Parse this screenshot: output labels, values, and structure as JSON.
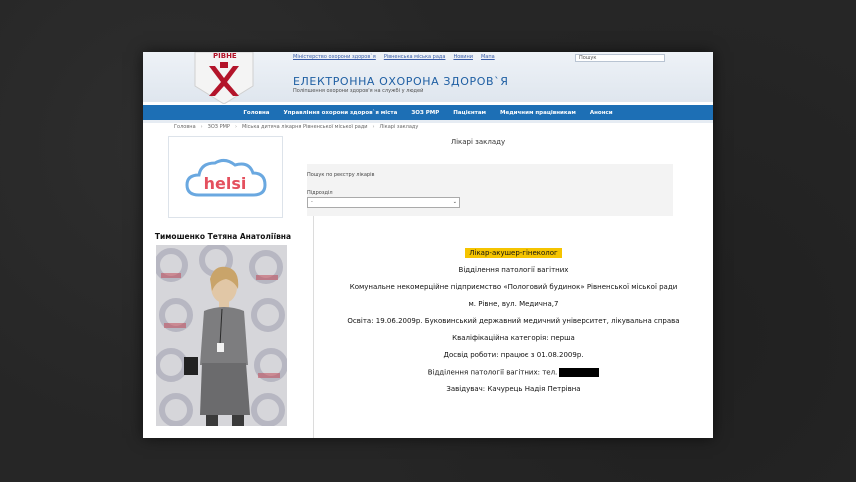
{
  "header": {
    "emblem_text": "РІВНЕ",
    "top_links": [
      "Міністерство охорони здоров`я",
      "Рівненська міська рада",
      "Новини",
      "Мапа"
    ],
    "search_placeholder": "Пошук",
    "title": "ЕЛЕКТРОННА ОХОРОНА ЗДОРОВ`Я",
    "subtitle": "Поліпшення охорони здоров'я на службі у людей"
  },
  "nav": [
    "Головна",
    "Управління охорони здоров`я міста",
    "ЗОЗ РМР",
    "Пацієнтам",
    "Медичним працівникам",
    "Анонси"
  ],
  "breadcrumbs": [
    "Головна",
    "ЗОЗ РМР",
    "Міська дитяча лікарня Рівненської міської ради",
    "Лікарі закладу"
  ],
  "helsi_logo": "helsi",
  "doctor_name": "Тимошенко Тетяна Анатоліївна",
  "section_title": "Лікарі закладу",
  "filter": {
    "search_label": "Пошук по реєстру лікарів",
    "department_label": "Підрозділ",
    "department_value": "-"
  },
  "details": {
    "specialty": "Лікар-акушер-гінеколог",
    "department": "Відділення патології вагітних",
    "institution": "Комунальне некомерційне підприємство «Пологовий будинок» Рівненської міської ради",
    "address": "м. Рівне, вул. Медична,7",
    "education": "Освіта:   19.06.2009р. Буковинський державний медичний університет, лікувальна справа",
    "qualification": "Кваліфікаційна категорія: перша",
    "experience": "Досвід роботи: працює з 01.08.2009р.",
    "phone_label": "Відділення патології вагітних: тел.",
    "head": "Завідувач: Качурець Надія Петрівна"
  },
  "colors": {
    "nav_blue": "#1d6fb5",
    "title_blue": "#1f5fa3",
    "highlight_yellow": "#f5c400",
    "emblem_red": "#b3142a"
  }
}
